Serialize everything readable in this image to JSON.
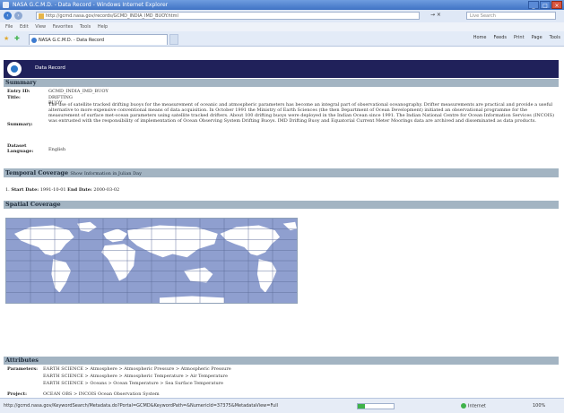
{
  "window": {
    "title": "NASA G.C.M.D. - Data Record - Windows Internet Explorer",
    "controls": [
      "_",
      "□",
      "×"
    ]
  },
  "address_bar": {
    "url": "http://gcmd.nasa.gov/records/GCMD_INDIA_IMD_BUOY.html",
    "search_placeholder": "Live Search",
    "go_label": "→ ×"
  },
  "menu": [
    "File",
    "Edit",
    "View",
    "Favorites",
    "Tools",
    "Help"
  ],
  "tab": {
    "label": "NASA G.C.M.D. - Data Record"
  },
  "command_bar": [
    "Home",
    "Feeds",
    "Print",
    "Page",
    "Tools"
  ],
  "banner": {
    "title": "Data Record"
  },
  "sections": {
    "summary": "Summary",
    "temporal": "Temporal Coverage",
    "temporal_sub": "Show Information in Julian Day",
    "spatial": "Spatial Coverage",
    "attributes": "Attributes"
  },
  "summary": {
    "entry_id_label": "Entry ID:",
    "entry_id": "GCMD_INDIA_IMD_BUOY",
    "title_label": "Title:",
    "title": "DRIFTING BUOY",
    "summary_label": "Summary:",
    "summary_text": "The use of satellite tracked drifting buoys for the measurement of oceanic and atmospheric parameters has become an integral part of observational oceanography. Drifter measurements are practical and provide a useful alternative to more expensive conventional means of data acquisition. In October 1991 the Ministry of Earth Sciences (the then Department of Ocean Development) initiated an observational programme for the measurement of surface met-ocean parameters using satellite tracked drifters. About 100 drifting buoys were deployed in the Indian Ocean since 1991. The Indian National Centre for Ocean Information Services (INCOIS) was entrusted with the responsibility of implementation of Ocean Observing System Drifting Buoys. IMD Drifting Buoy and Equatorial Current Meter Moorings data are archived and disseminated as data products.",
    "language_label": "Dataset Language:",
    "language": "English"
  },
  "temporal": {
    "start_label": "Start Date:",
    "start": "1991-10-01",
    "end_label": "End Date:",
    "end": "2000-03-02"
  },
  "attributes": {
    "parameters_label": "Parameters:",
    "parameters": [
      "EARTH SCIENCE > Atmosphere > Atmospheric Pressure > Atmospheric Pressure",
      "EARTH SCIENCE > Atmosphere > Atmospheric Temperature > Air Temperature",
      "EARTH SCIENCE > Oceans > Ocean Temperature > Sea Surface Temperature"
    ],
    "project_label": "Project:",
    "project": "OCEAN OBS > INCOIS Ocean Observation System"
  },
  "status_bar": {
    "url": "http://gcmd.nasa.gov/KeywordSearch/Metadata.do?Portal=GCMD&KeywordPath=&NumericId=37375&MetadataView=Full",
    "zone": "Internet",
    "zoom": "100%",
    "progress": 0.2
  },
  "colors": {
    "banner": "#20215a",
    "section": "#a3b4c2",
    "ocean": "#8f9fcf",
    "land": "#ffffff"
  }
}
